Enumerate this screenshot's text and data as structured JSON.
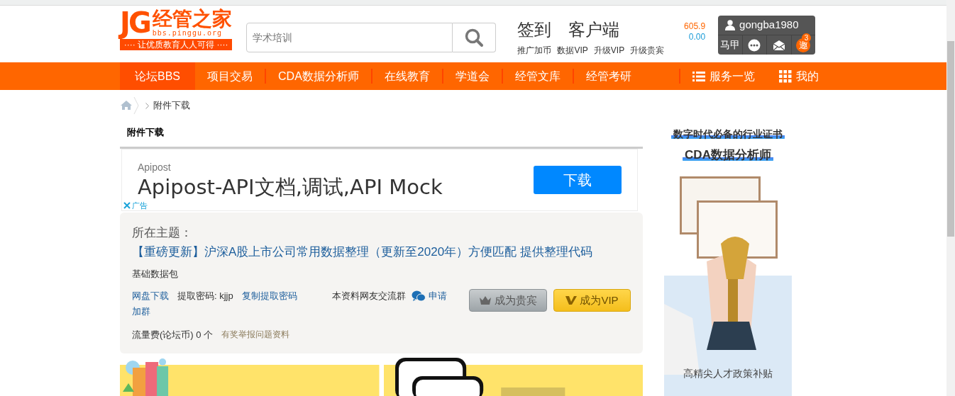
{
  "header": {
    "logo": {
      "mark": "JG",
      "name": "经管之家",
      "domain": "bbs.pinggu.org",
      "slogan": "···· 让优质教育人人可得 ····"
    },
    "search": {
      "placeholder": "学术培训"
    },
    "quick_links": [
      "签到",
      "客户端"
    ],
    "balances": [
      {
        "value": "605.9",
        "color": "#ff6600"
      },
      {
        "value": "0.00",
        "color": "#1a9bd7"
      }
    ],
    "sub_links": [
      "推广加币",
      "数据VIP",
      "升级VIP",
      "升级贵宾"
    ],
    "user": {
      "name": "gongba1980",
      "tools": [
        {
          "kind": "text",
          "label": "马甲"
        },
        {
          "kind": "chat"
        },
        {
          "kind": "mail"
        },
        {
          "kind": "invite",
          "label": "邀",
          "badge": "3"
        }
      ]
    }
  },
  "nav": {
    "items": [
      {
        "label": "论坛BBS",
        "selected": true
      },
      {
        "label": "项目交易",
        "selected": false
      },
      {
        "label": "CDA数据分析师",
        "selected": false
      },
      {
        "label": "在线教育",
        "selected": false
      },
      {
        "label": "学道会",
        "selected": false
      },
      {
        "label": "经管文库",
        "selected": false
      },
      {
        "label": "经管考研",
        "selected": false
      }
    ],
    "right_items": [
      {
        "kind": "list",
        "label": "服务一览"
      },
      {
        "kind": "grid",
        "label": "我的"
      }
    ]
  },
  "breadcrumb": [
    "附件下载"
  ],
  "section_title": "附件下载",
  "ad": {
    "brand": "Apipost",
    "headline": "Apipost-API文档,调试,API Mock",
    "button": "下载",
    "ad_label": "广告"
  },
  "topic": {
    "label": "所在主题：",
    "title": "【重磅更新】沪深A股上市公司常用数据整理（更新至2020年）方便匹配 提供整理代码",
    "tag": "基础数据包",
    "download_links": [
      {
        "kind": "link",
        "text": "网盘下载"
      },
      {
        "kind": "text",
        "text": "提取密码: kjjp"
      },
      {
        "kind": "link",
        "text": "复制提取密码"
      },
      {
        "kind": "link",
        "text": "加群"
      }
    ],
    "group_label": "本资料网友交流群",
    "group_link": "申请",
    "buttons": [
      {
        "kind": "guest",
        "label": "成为贵宾"
      },
      {
        "kind": "vip",
        "label": "成为VIP"
      }
    ],
    "fee": "流量费(论坛币) 0 个",
    "report": "有奖举报问题资料"
  },
  "sidebar": {
    "headline": "数字时代必备的行业证书",
    "title": "CDA数据分析师",
    "caption": "高精尖人才政策补贴"
  }
}
